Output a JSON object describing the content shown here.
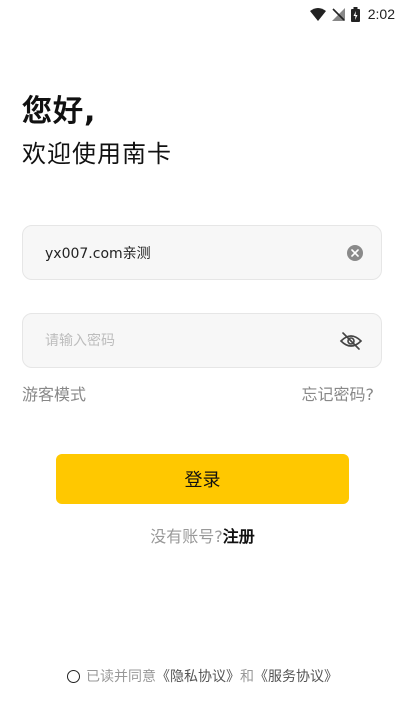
{
  "status_bar": {
    "time": "2:02",
    "icons": [
      "wifi-icon",
      "no-signal-icon",
      "battery-icon"
    ]
  },
  "greeting": {
    "title": "您好,",
    "subtitle": "欢迎使用南卡"
  },
  "username_field": {
    "value": "yx007.com亲测",
    "clear_icon": "clear-icon"
  },
  "password_field": {
    "placeholder": "请输入密码",
    "visibility_icon": "eye-off-icon"
  },
  "links": {
    "guest_mode": "游客模式",
    "forgot_password": "忘记密码?"
  },
  "login_button": {
    "label": "登录",
    "color": "#ffc800"
  },
  "register": {
    "prompt": "没有账号?",
    "link": "注册"
  },
  "agreement": {
    "prefix": "已读并同意",
    "privacy": "《隐私协议》",
    "and": "和",
    "service": "《服务协议》"
  }
}
